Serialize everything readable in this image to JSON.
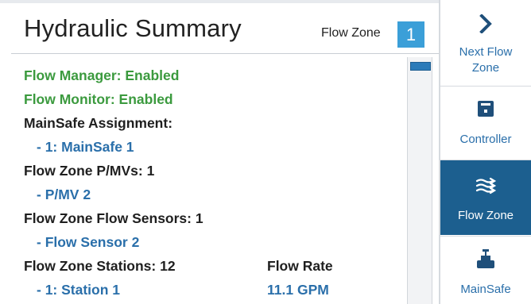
{
  "header": {
    "title": "Hydraulic Summary",
    "flow_zone_label": "Flow Zone",
    "flow_zone_value": "1"
  },
  "summary": {
    "flow_manager": "Flow Manager: Enabled",
    "flow_monitor": "Flow Monitor: Enabled",
    "mainsafe_heading": "MainSafe Assignment:",
    "mainsafe_item": "- 1: MainSafe 1",
    "pmv_heading": "Flow Zone P/MVs: 1",
    "pmv_item": "- P/MV 2",
    "sensors_heading": "Flow Zone Flow Sensors: 1",
    "sensor_item": "- Flow Sensor 2",
    "stations_heading": "Flow Zone Stations: 12",
    "flow_rate_heading": "Flow Rate",
    "station_item": "- 1: Station 1",
    "station_rate": "11.1 GPM"
  },
  "sidebar": {
    "next_label_line1": "Next Flow",
    "next_label_line2": "Zone",
    "controller_label": "Controller",
    "flowzone_label": "Flow Zone",
    "mainsafe_label": "MainSafe"
  },
  "colors": {
    "enabled": "#3b9a3e",
    "accent_blue": "#2a6faa",
    "active_tab": "#1c5f8f",
    "flow_zone_box": "#3b9fd8"
  }
}
